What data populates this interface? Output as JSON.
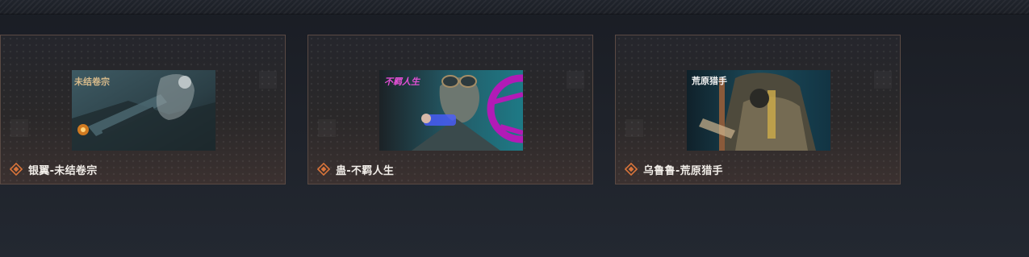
{
  "cards": [
    {
      "title": "银翼-未结卷宗",
      "thumb_logo": "未结卷宗"
    },
    {
      "title": "蛊-不羁人生",
      "thumb_logo": "不羁人生"
    },
    {
      "title": "乌鲁鲁-荒原猎手",
      "thumb_logo": "荒原猎手"
    }
  ],
  "colors": {
    "accent": "#d9743a",
    "card_border": "#5a4a44",
    "title_text": "#f1ede8"
  },
  "icons": {
    "caption_icon": "diamond-icon"
  }
}
